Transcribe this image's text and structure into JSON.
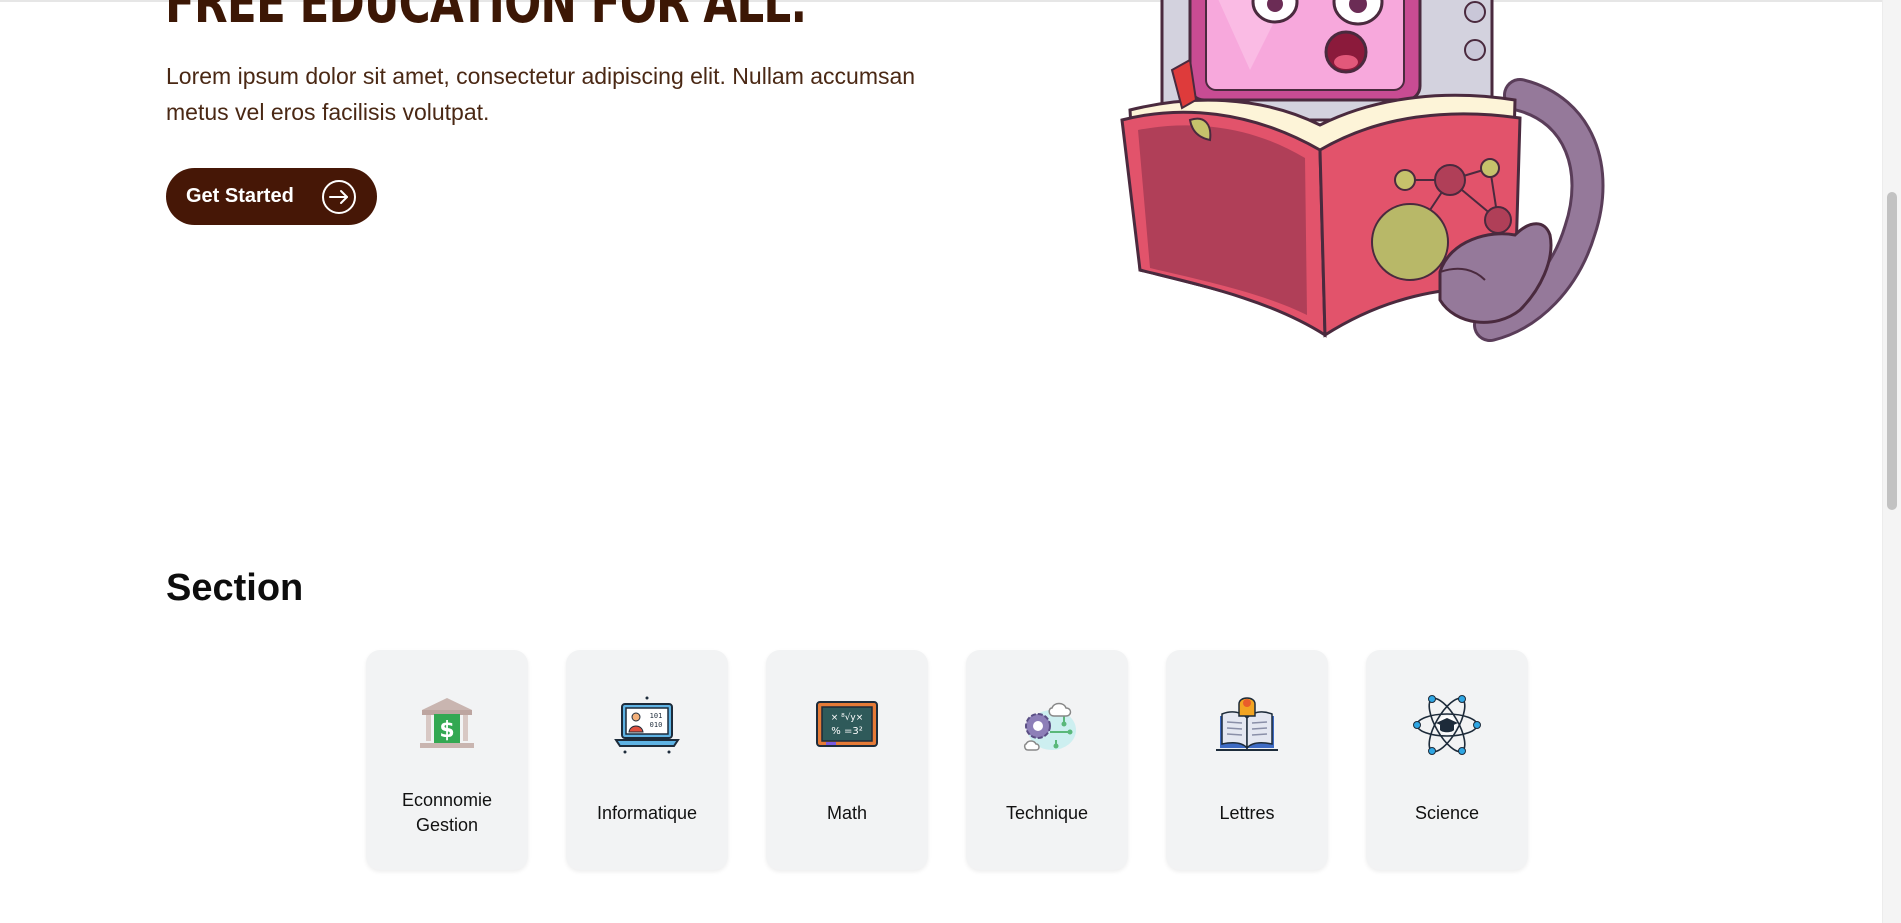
{
  "hero": {
    "title": "FREE EDUCATION FOR ALL.",
    "description": "Lorem ipsum dolor sit amet, consectetur adipiscing elit. Nullam accumsan metus vel eros facilisis volutpat.",
    "cta_label": "Get Started",
    "cta_icon": "arrow-right-circle-icon",
    "illustration": "robot-reading-book"
  },
  "colors": {
    "brand_dark": "#461706",
    "title_brown": "#3c1705",
    "card_bg": "#f2f3f4"
  },
  "section": {
    "title": "Section",
    "cards": [
      {
        "label": "Econnomie Gestion",
        "icon": "bank-icon"
      },
      {
        "label": "Informatique",
        "icon": "laptop-code-icon"
      },
      {
        "label": "Math",
        "icon": "chalkboard-icon"
      },
      {
        "label": "Technique",
        "icon": "gear-circuit-icon"
      },
      {
        "label": "Lettres",
        "icon": "open-book-icon"
      },
      {
        "label": "Science",
        "icon": "atom-icon"
      }
    ]
  }
}
